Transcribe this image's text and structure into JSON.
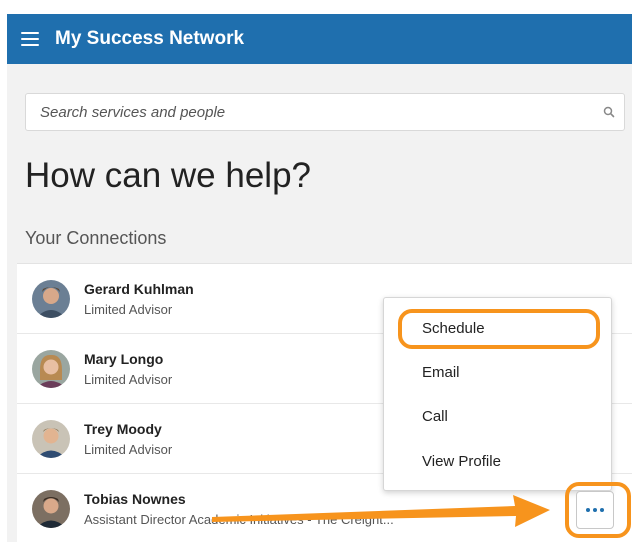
{
  "header": {
    "title": "My Success Network",
    "menu_icon": "hamburger-menu-icon",
    "bg_color": "#1f6fae"
  },
  "search": {
    "placeholder": "Search services and people",
    "icon": "search-icon"
  },
  "main": {
    "heading": "How can we help?",
    "connections_title": "Your Connections"
  },
  "connections": [
    {
      "name": "Gerard Kuhlman",
      "role": "Limited Advisor"
    },
    {
      "name": "Mary Longo",
      "role": "Limited Advisor"
    },
    {
      "name": "Trey Moody",
      "role": "Limited Advisor"
    },
    {
      "name": "Tobias Nownes",
      "role": "Assistant Director Academic Initiatives - The Creight..."
    }
  ],
  "context_menu": {
    "items": [
      "Schedule",
      "Email",
      "Call",
      "View Profile"
    ],
    "highlighted": "Schedule"
  },
  "more_button": {
    "icon": "more-dots-icon"
  },
  "annotation": {
    "color": "#f7941d"
  }
}
